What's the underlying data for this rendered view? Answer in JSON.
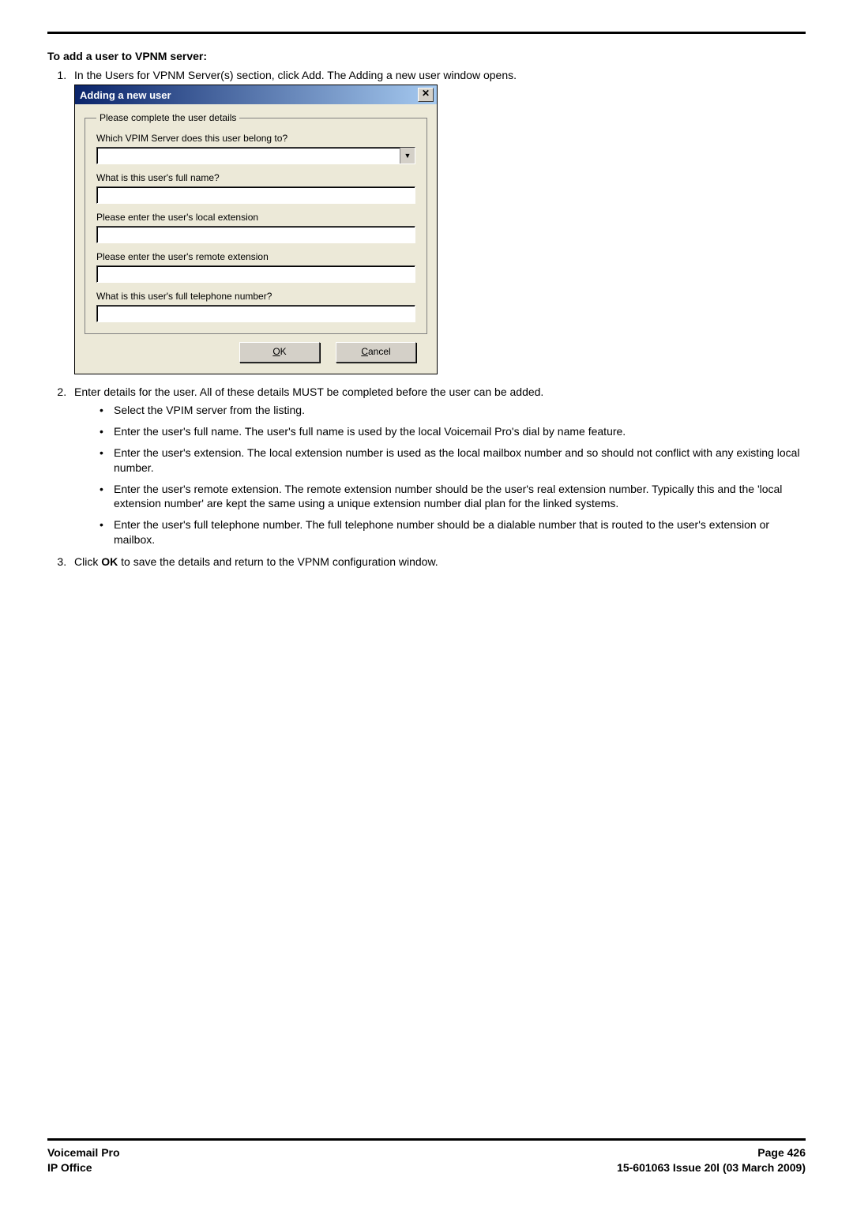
{
  "heading": "To add a user to VPNM server:",
  "steps": {
    "step1": "In the Users for VPNM Server(s) section, click Add. The Adding a new user window opens.",
    "step2_intro": "Enter details for the user. All of these details MUST be completed before the user can be added.",
    "step2_bullets": [
      "Select the VPIM server from the listing.",
      "Enter the user's full name. The user's full name is used by the local Voicemail Pro's dial by name feature.",
      "Enter the user's extension. The local extension number is used as the local mailbox number and so should not conflict with any existing local number.",
      "Enter the user's remote extension. The remote extension number should be the user's real extension number. Typically this and the 'local extension number' are kept the same using a unique extension number dial plan for the linked systems.",
      "Enter the user's full telephone number. The full telephone number should be a dialable number that is routed to the user's extension or mailbox."
    ],
    "step3_prefix": "Click ",
    "step3_bold": "OK",
    "step3_suffix": " to save the details and return to the VPNM configuration window."
  },
  "dialog": {
    "title": "Adding a new user",
    "groupbox_legend": "Please complete the user details",
    "labels": {
      "server": "Which VPIM Server does this user belong to?",
      "fullname": "What is this user's full name?",
      "local_ext": "Please enter the user's local extension",
      "remote_ext": "Please enter the user's remote extension",
      "phone": "What is this user's full telephone number?"
    },
    "values": {
      "server": "",
      "fullname": "",
      "local_ext": "",
      "remote_ext": "",
      "phone": ""
    },
    "buttons": {
      "ok_m": "O",
      "ok_rest": "K",
      "cancel_m": "C",
      "cancel_rest": "ancel"
    }
  },
  "footer": {
    "left1": "Voicemail Pro",
    "left2": "IP Office",
    "right1": "Page 426",
    "right2": "15-601063 Issue 20l (03 March 2009)"
  }
}
